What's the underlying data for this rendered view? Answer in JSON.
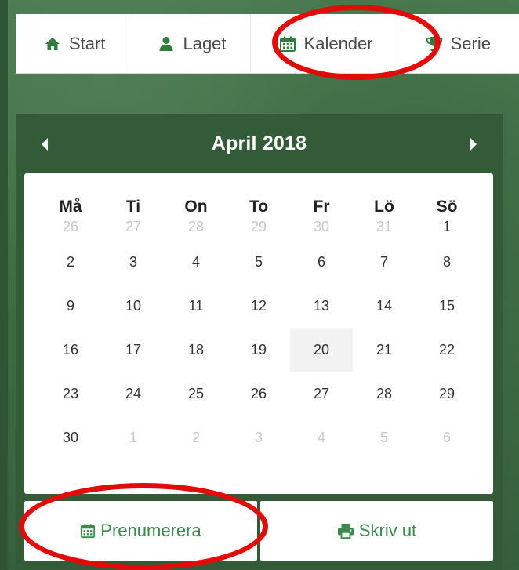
{
  "nav": {
    "items": [
      {
        "label": "Start",
        "icon": "home-icon"
      },
      {
        "label": "Laget",
        "icon": "user-icon"
      },
      {
        "label": "Kalender",
        "icon": "calendar-icon"
      },
      {
        "label": "Serie",
        "icon": "trophy-icon"
      }
    ]
  },
  "calendar": {
    "title": "April 2018",
    "weekdays": [
      "Må",
      "Ti",
      "On",
      "To",
      "Fr",
      "Lö",
      "Sö"
    ],
    "weeks": [
      [
        {
          "d": "26",
          "muted": true
        },
        {
          "d": "27",
          "muted": true
        },
        {
          "d": "28",
          "muted": true
        },
        {
          "d": "29",
          "muted": true
        },
        {
          "d": "30",
          "muted": true
        },
        {
          "d": "31",
          "muted": true
        },
        {
          "d": "1",
          "muted": false
        }
      ],
      [
        {
          "d": "2",
          "muted": false
        },
        {
          "d": "3",
          "muted": false
        },
        {
          "d": "4",
          "muted": false
        },
        {
          "d": "5",
          "muted": false
        },
        {
          "d": "6",
          "muted": false
        },
        {
          "d": "7",
          "muted": false
        },
        {
          "d": "8",
          "muted": false
        }
      ],
      [
        {
          "d": "9",
          "muted": false
        },
        {
          "d": "10",
          "muted": false
        },
        {
          "d": "11",
          "muted": false
        },
        {
          "d": "12",
          "muted": false
        },
        {
          "d": "13",
          "muted": false
        },
        {
          "d": "14",
          "muted": false
        },
        {
          "d": "15",
          "muted": false
        }
      ],
      [
        {
          "d": "16",
          "muted": false
        },
        {
          "d": "17",
          "muted": false
        },
        {
          "d": "18",
          "muted": false
        },
        {
          "d": "19",
          "muted": false
        },
        {
          "d": "20",
          "muted": false,
          "today": true
        },
        {
          "d": "21",
          "muted": false
        },
        {
          "d": "22",
          "muted": false
        }
      ],
      [
        {
          "d": "23",
          "muted": false
        },
        {
          "d": "24",
          "muted": false
        },
        {
          "d": "25",
          "muted": false
        },
        {
          "d": "26",
          "muted": false
        },
        {
          "d": "27",
          "muted": false
        },
        {
          "d": "28",
          "muted": false
        },
        {
          "d": "29",
          "muted": false
        }
      ],
      [
        {
          "d": "30",
          "muted": false
        },
        {
          "d": "1",
          "muted": true
        },
        {
          "d": "2",
          "muted": true
        },
        {
          "d": "3",
          "muted": true
        },
        {
          "d": "4",
          "muted": true
        },
        {
          "d": "5",
          "muted": true
        },
        {
          "d": "6",
          "muted": true
        }
      ]
    ],
    "subscribe_label": "Prenumerera",
    "print_label": "Skriv ut"
  },
  "colors": {
    "accent_green": "#3b8a4a",
    "panel_green": "#345b38",
    "annotation_red": "#e30a0a"
  }
}
